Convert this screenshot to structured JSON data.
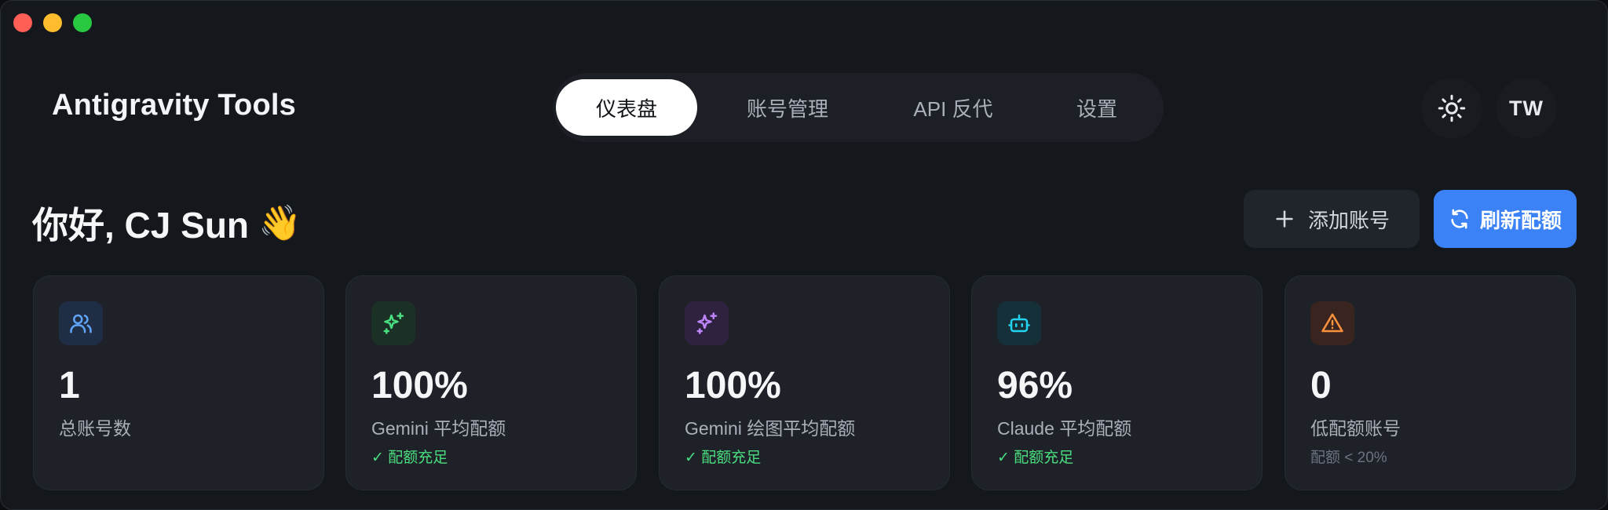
{
  "app": {
    "title": "Antigravity Tools"
  },
  "nav": {
    "tabs": [
      {
        "label": "仪表盘",
        "active": true
      },
      {
        "label": "账号管理",
        "active": false
      },
      {
        "label": "API 反代",
        "active": false
      },
      {
        "label": "设置",
        "active": false
      }
    ]
  },
  "header": {
    "theme_icon": "sun-icon",
    "avatar_initials": "TW"
  },
  "greeting": {
    "text": "你好, CJ Sun",
    "emoji": "👋"
  },
  "actions": {
    "add_account_label": "添加账号",
    "refresh_quota_label": "刷新配额"
  },
  "colors": {
    "accent_blue": "#3b82f6",
    "status_green": "#4ade80",
    "icon_blue": "#60a5fa",
    "icon_green": "#4ade80",
    "icon_purple": "#c084fc",
    "icon_cyan": "#22d3ee",
    "icon_orange": "#fb923c"
  },
  "stats": [
    {
      "icon": "users-icon",
      "value": "1",
      "label": "总账号数",
      "status": ""
    },
    {
      "icon": "sparkles-icon",
      "value": "100%",
      "label": "Gemini 平均配额",
      "status": "✓ 配额充足"
    },
    {
      "icon": "sparkles-icon",
      "value": "100%",
      "label": "Gemini 绘图平均配额",
      "status": "✓ 配额充足"
    },
    {
      "icon": "bot-icon",
      "value": "96%",
      "label": "Claude 平均配额",
      "status": "✓ 配额充足"
    },
    {
      "icon": "warning-icon",
      "value": "0",
      "label": "低配额账号",
      "status": "配额 < 20%"
    }
  ]
}
